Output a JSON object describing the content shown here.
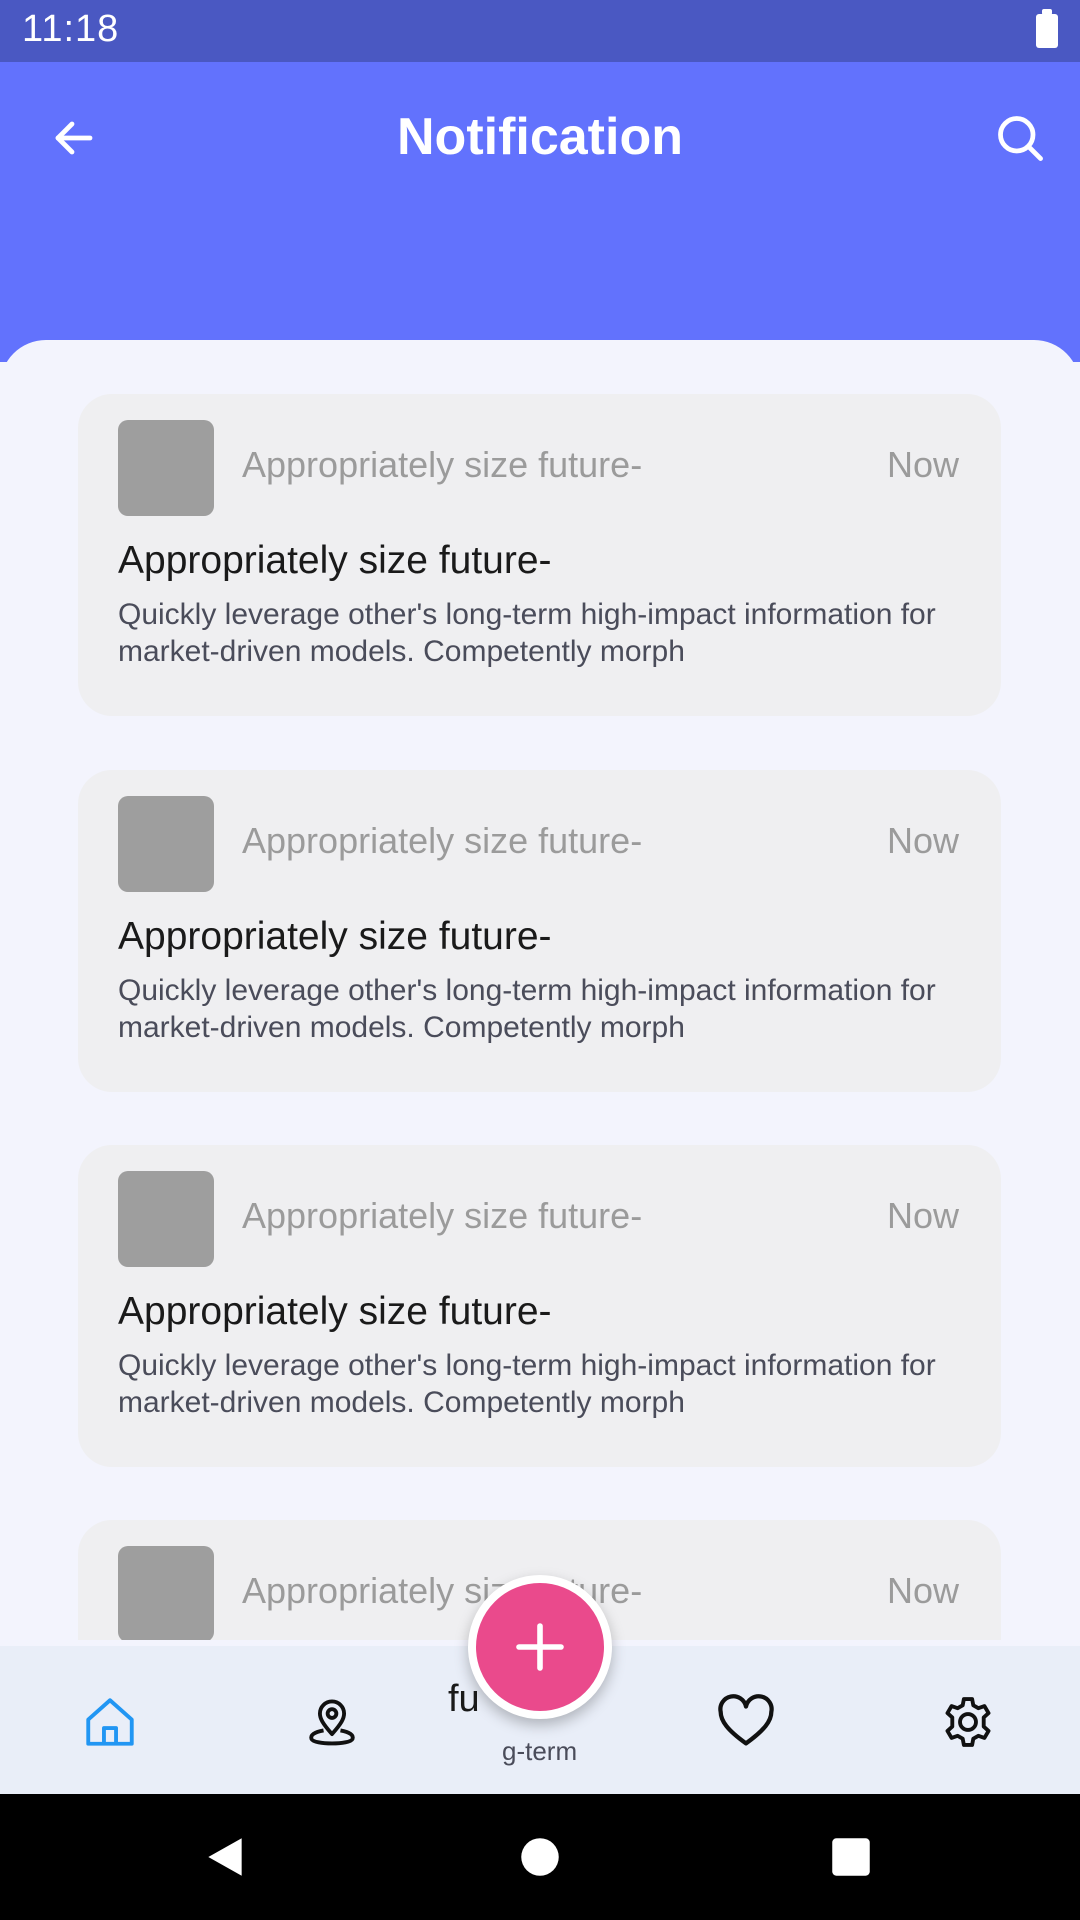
{
  "status_bar": {
    "time": "11:18"
  },
  "app_bar": {
    "title": "Notification"
  },
  "notifications": [
    {
      "subtitle": "Appropriately size future-",
      "time": "Now",
      "title": "Appropriately size future-",
      "body": "Quickly leverage other's long-term high-impact information for market-driven models. Competently morph"
    },
    {
      "subtitle": "Appropriately size future-",
      "time": "Now",
      "title": "Appropriately size future-",
      "body": "Quickly leverage other's long-term high-impact information for market-driven models. Competently morph"
    },
    {
      "subtitle": "Appropriately size future-",
      "time": "Now",
      "title": "Appropriately size future-",
      "body": "Quickly leverage other's long-term high-impact information for market-driven models. Competently morph"
    },
    {
      "subtitle": "Appropriately size future-",
      "time": "Now"
    }
  ],
  "bottom_peek": {
    "title": "fu",
    "body": "g-term"
  },
  "bottom_nav": {
    "items": [
      {
        "icon": "home-icon",
        "active": true
      },
      {
        "icon": "location-pin-icon",
        "active": false
      },
      {
        "icon": "heart-icon",
        "active": false
      },
      {
        "icon": "gear-icon",
        "active": false
      }
    ]
  },
  "colors": {
    "status_bar": "#4a58c2",
    "app_bar": "#6272fd",
    "fab": "#ea4a8c",
    "active_nav": "#2196f3"
  }
}
